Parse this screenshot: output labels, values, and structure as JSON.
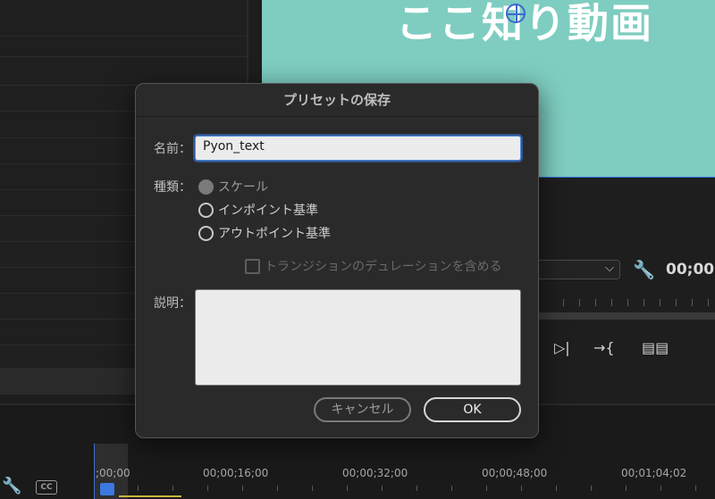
{
  "preview": {
    "title_text": "ここ知り動画"
  },
  "monitor": {
    "timecode": "00;00;",
    "dropdown_chevron": "⌵"
  },
  "timeline": {
    "timecodes": [
      "00;00;16;00",
      "00;00;32;00",
      "00;00;48;00",
      "00;01;04;02"
    ],
    "start_timecode": ";00;00",
    "cc_label": "CC"
  },
  "dialog": {
    "title": "プリセットの保存",
    "name_label": "名前：",
    "name_value": "Pyon_text",
    "type_label": "種類：",
    "type_options": [
      "スケール",
      "インポイント基準",
      "アウトポイント基準"
    ],
    "selected_type": "スケール",
    "transition_checkbox_label": "トランジションのデュレーションを含める",
    "description_label": "説明：",
    "description_value": "",
    "cancel_label": "キャンセル",
    "ok_label": "OK"
  },
  "colors": {
    "preview_bg": "#7ecdc0",
    "accent_blue": "#3b78e0",
    "dialog_bg": "#2a2a2a"
  },
  "icons": [
    "wrench-icon",
    "crosshair-icon",
    "play-next-icon",
    "step-forward-icon",
    "export-frame-icon",
    "cc-icon",
    "chevron-down-icon"
  ]
}
